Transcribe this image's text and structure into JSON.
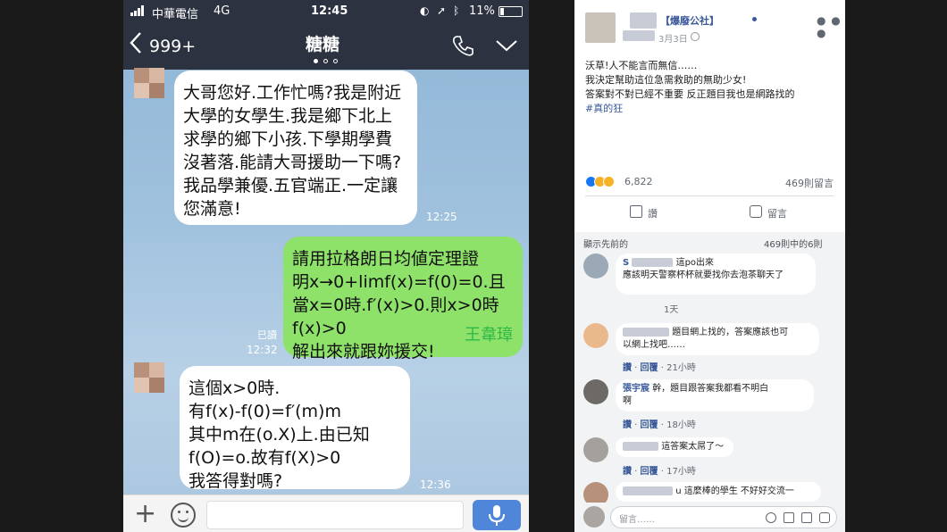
{
  "phone": {
    "status": {
      "carrier": "中華電信",
      "network": "4G",
      "time": "12:45",
      "battery": "11%"
    },
    "header": {
      "back_count": "999+",
      "contact_name": "糖糖"
    },
    "messages": [
      {
        "side": "left",
        "text": "大哥您好.工作忙嗎?我是附近\n大學的女學生.我是鄉下北上\n求學的鄉下小孩.下學期學費\n沒著落.能請大哥援助一下嗎?\n我品學兼優.五官端正.一定讓\n您滿意!",
        "time": "12:25"
      },
      {
        "side": "right",
        "text": "請用拉格朗日均値定理證\n明x→0+limf(x)=f(0)=0.且\n當x=0時.f′(x)>0.則x>0時\nf(x)>0\n解出來就跟妳援交!",
        "read": "已讀",
        "time": "12:32",
        "signature": "王韋璋"
      },
      {
        "side": "left",
        "text": "這個x>0時.\n有f(x)-f(0)=f′(m)m\n其中m在(o.X)上.由已知\nf(O)=o.故有f(X)>0\n我答得對嗎?",
        "time": "12:36"
      }
    ]
  },
  "post": {
    "page_name": "【爆廢公社】",
    "date": "3月3日",
    "body_lines": [
      "沃草!人不能言而無信……",
      "我決定幫助這位急需救助的無助少女!",
      "答案對不對已經不重要 反正題目我也是網路找的"
    ],
    "hashtag": "#真的狂",
    "reaction_count": "6,822",
    "comment_count": "469則留言",
    "actions": {
      "like": "讚",
      "comment": "留言"
    },
    "comments_header": {
      "left": "顯示先前的",
      "right": "469則中的6則"
    },
    "comments": [
      {
        "name": "S",
        "text": "這po出來\n應該明天警察杯杯就要找你去泡茶聊天了",
        "foot": "1天"
      },
      {
        "name": "",
        "text": "題目網上找的，答案應該也可\n以網上找吧……",
        "like": "讚",
        "reply": "回覆",
        "foot": "21小時"
      },
      {
        "name": "張宇宸",
        "text": "幹，題目跟答案我都看不明白\n啊",
        "like": "讚",
        "reply": "回覆",
        "foot": "18小時"
      },
      {
        "name": "",
        "text": "這答案太屌了～",
        "like": "讚",
        "reply": "回覆",
        "foot": "17小時"
      },
      {
        "name": "",
        "text": "u 這麼棒的學生 不好好交流一",
        "foot": ""
      }
    ],
    "compose_placeholder": "留言……"
  },
  "colors": {
    "chat_header": "#2c3240",
    "chat_background": "#9fc1dd",
    "sent_bubble": "#8ee26a",
    "signature_green": "#2fb848",
    "fb_link": "#385898",
    "mic_button": "#4f86d9"
  }
}
